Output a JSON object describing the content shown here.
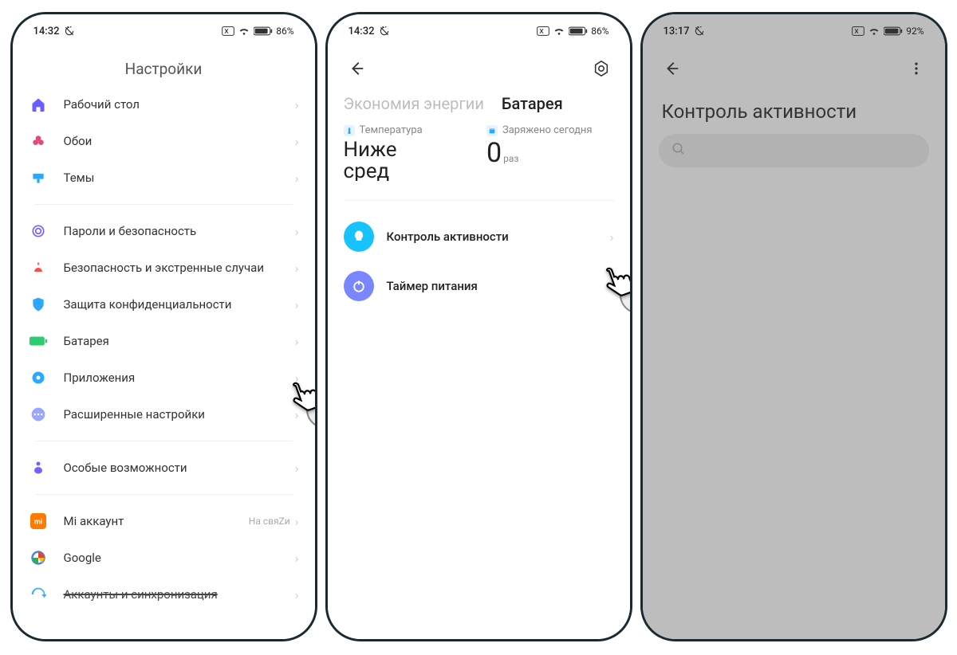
{
  "phone1": {
    "status": {
      "time": "14:32",
      "battery": "86%"
    },
    "header_title": "Настройки",
    "group1": [
      {
        "label": "Рабочий стол",
        "icon": "home",
        "color": "#6b5cff"
      },
      {
        "label": "Обои",
        "icon": "flower",
        "color": "#e14a7a"
      },
      {
        "label": "Темы",
        "icon": "brush",
        "color": "#2aa7ff"
      }
    ],
    "group2": [
      {
        "label": "Пароли и безопасность",
        "icon": "fingerprint",
        "color": "#7a5cff"
      },
      {
        "label": "Безопасность и экстренные случаи",
        "icon": "alert",
        "color": "#ff4d4d"
      },
      {
        "label": "Защита конфиденциальности",
        "icon": "shield",
        "color": "#2aa7ff"
      },
      {
        "label": "Батарея",
        "icon": "battery",
        "color": "#2ecc71"
      },
      {
        "label": "Приложения",
        "icon": "gear",
        "color": "#2aa7ff"
      },
      {
        "label": "Расширенные настройки",
        "icon": "dots",
        "color": "#9aa7ff"
      }
    ],
    "group3": [
      {
        "label": "Особые возможности",
        "icon": "access",
        "color": "#7a5cff"
      }
    ],
    "group4": [
      {
        "label": "Mi аккаунт",
        "sub": "На свяZи",
        "icon": "mi",
        "color": "#ff7a00"
      },
      {
        "label": "Google",
        "icon": "google",
        "color": "#4285f4"
      },
      {
        "label": "Аккаунты и синхронизация",
        "icon": "sync",
        "color": "#2aa7ff"
      }
    ]
  },
  "phone2": {
    "status": {
      "time": "14:32",
      "battery": "86%"
    },
    "tabs": {
      "inactive": "Экономия энергии",
      "active": "Батарея"
    },
    "stat_temp": {
      "label": "Температура",
      "value_lines": [
        "Ниже",
        "сред"
      ]
    },
    "stat_charged": {
      "label": "Заряжено сегодня",
      "value": "0",
      "unit": "раз"
    },
    "options": [
      {
        "label": "Контроль активности",
        "icon": "bulb",
        "color": "#17c2ff"
      },
      {
        "label": "Таймер питания",
        "icon": "power",
        "color": "#7a86ff"
      }
    ]
  },
  "phone3": {
    "status": {
      "time": "13:17",
      "battery": "92%"
    },
    "title": "Контроль активности",
    "search_placeholder": ""
  }
}
